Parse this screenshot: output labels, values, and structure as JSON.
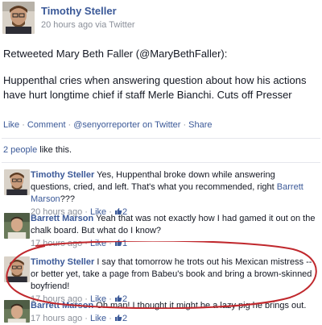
{
  "post": {
    "author": "Timothy Steller",
    "time": "20 hours ago",
    "via": "via Twitter",
    "retweet_line": "Retweeted Mary Beth Faller (@MaryBethFaller):",
    "body": "Huppenthal cries when answering question about how his actions have hurt longtime chief if staff Merle Bianchi. Cuts off Presser",
    "actions": [
      "Like",
      "Comment",
      "@senyorreporter on Twitter",
      "Share"
    ],
    "likes_count_text": "2 people",
    "likes_suffix": " like this."
  },
  "comments": [
    {
      "author": "Timothy Steller",
      "text": " Yes, Huppenthal broke down while answering questions, cried, and left. That's what you recommended, right ",
      "mention": "Barrett Marson",
      "text_after": "???",
      "time": "20 hours ago",
      "like_label": "Like",
      "like_count": "2"
    },
    {
      "author": "Barrett Marson",
      "text": " Yeah that was not exactly how I had gamed it out on the chalk board. But what do I know?",
      "mention": "",
      "text_after": "",
      "time": "17 hours ago",
      "like_label": "Like",
      "like_count": "1"
    },
    {
      "author": "Timothy Steller",
      "text": " I say that tomorrow he trots out his Mexican mistress -- or better yet, take a page from Babeu's book and bring a brown-skinned boyfriend!",
      "mention": "",
      "text_after": "",
      "time": "17 hours ago",
      "like_label": "Like",
      "like_count": "2"
    },
    {
      "author": "Barrett Marson",
      "text": " Oh man! I thought it might be a lazy pig he brings out.",
      "mention": "",
      "text_after": "",
      "time": "17 hours ago",
      "like_label": "Like",
      "like_count": "2"
    }
  ],
  "colors": {
    "link_blue": "#3b5998",
    "muted_grey": "#8a8f99",
    "annotation_red": "#c0282d"
  },
  "icons": [
    "profile-photo-steller",
    "profile-photo-marson",
    "thumbs-up-icon",
    "hand-drawn-ellipse"
  ]
}
